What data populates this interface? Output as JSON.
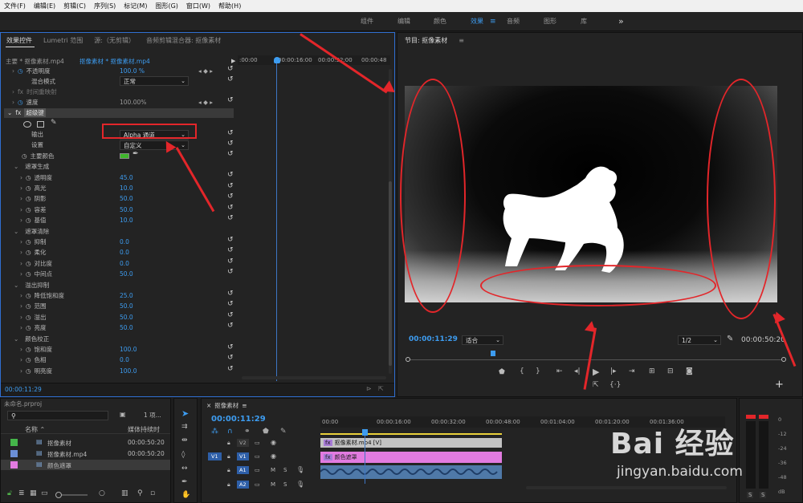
{
  "menu": [
    "文件(F)",
    "编辑(E)",
    "剪辑(C)",
    "序列(S)",
    "标记(M)",
    "图形(G)",
    "窗口(W)",
    "帮助(H)"
  ],
  "workspaces": [
    "组件",
    "编辑",
    "颜色",
    "效果",
    "音频",
    "图形",
    "库",
    "»"
  ],
  "effect_controls": {
    "tabs": [
      "效果控件",
      "Lumetri 范围",
      "源:（无剪辑）",
      "音频剪辑混合器: 抠像素材"
    ],
    "clip_path": "主要 * 抠像素材.mp4",
    "clip_link": "抠像素材 * 抠像素材.mp4",
    "mini_ruler": [
      ":00:00",
      "00:00:16:00",
      "00:00:32:00",
      "00:00:48"
    ],
    "opacity_label": "不透明度",
    "opacity_value": "100.0 %",
    "blend_label": "混合模式",
    "blend_value": "正常",
    "time_remap": "时间重映射",
    "speed_label": "速度",
    "speed_value": "100.00%",
    "ultra_key": "超级键",
    "output_label": "输出",
    "output_value": "Alpha 通道",
    "setting_label": "设置",
    "setting_value": "自定义",
    "key_color_label": "主要颜色",
    "key_color": "#3fb62c",
    "groups": [
      {
        "name": "遮罩生成",
        "params": [
          [
            "透明度",
            "45.0"
          ],
          [
            "高光",
            "10.0"
          ],
          [
            "阴影",
            "50.0"
          ],
          [
            "容差",
            "50.0"
          ],
          [
            "基值",
            "10.0"
          ]
        ]
      },
      {
        "name": "遮罩清除",
        "params": [
          [
            "抑制",
            "0.0"
          ],
          [
            "柔化",
            "0.0"
          ],
          [
            "对比度",
            "0.0"
          ],
          [
            "中间点",
            "50.0"
          ]
        ]
      },
      {
        "name": "溢出抑制",
        "params": [
          [
            "降低饱和度",
            "25.0"
          ],
          [
            "范围",
            "50.0"
          ],
          [
            "溢出",
            "50.0"
          ],
          [
            "亮度",
            "50.0"
          ]
        ]
      },
      {
        "name": "颜色校正",
        "params": [
          [
            "饱和度",
            "100.0"
          ],
          [
            "色相",
            "0.0"
          ],
          [
            "明亮度",
            "100.0"
          ]
        ]
      }
    ],
    "timecode": "00:00:11:29"
  },
  "program": {
    "title": "节目: 抠像素材",
    "timecode": "00:00:11:29",
    "fit": "适合",
    "resolution": "1/2",
    "duration": "00:00:50:20"
  },
  "project": {
    "title": "未命名.prproj",
    "count": "1 项...",
    "col_name": "名称",
    "col_start": "媒体持续时",
    "items": [
      {
        "name": "抠像素材",
        "duration": "00:00:50:20",
        "color": "#45b64a"
      },
      {
        "name": "抠像素材.mp4",
        "duration": "00:00:50:20",
        "color": "#6b8fd6"
      },
      {
        "name": "颜色遮罩",
        "duration": "",
        "color": "#e27be0"
      }
    ]
  },
  "timeline": {
    "title": "抠像素材",
    "timecode": "00:00:11:29",
    "ruler": [
      "00:00",
      "00:00:16:00",
      "00:00:32:00",
      "00:00:48:00",
      "00:01:04:00",
      "00:01:20:00",
      "00:01:36:00"
    ],
    "tracks": [
      "V2",
      "V1",
      "A1",
      "A2"
    ],
    "clip_v2": "抠像素材.mp4 [V]",
    "clip_v1": "颜色遮罩"
  },
  "meter_labels": [
    "0",
    "-12",
    "-24",
    "-36",
    "-48",
    "dB"
  ],
  "watermark": {
    "brand": "Bai 经验",
    "url": "jingyan.baidu.com"
  }
}
